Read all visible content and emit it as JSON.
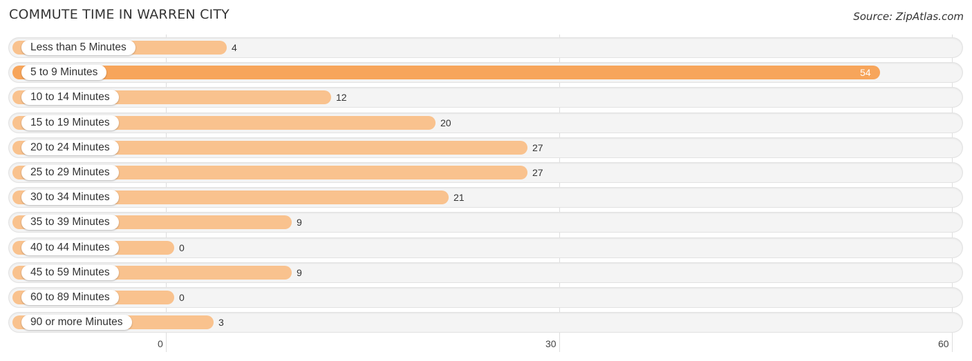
{
  "header": {
    "title": "COMMUTE TIME IN WARREN CITY",
    "source": "Source: ZipAtlas.com"
  },
  "colors": {
    "bar_normal": "#f9c28e",
    "bar_highlight": "#f7a55b",
    "row_background": "#f4f4f4"
  },
  "chart_data": {
    "type": "bar",
    "orientation": "horizontal",
    "title": "COMMUTE TIME IN WARREN CITY",
    "xlabel": "",
    "ylabel": "",
    "categories": [
      "Less than 5 Minutes",
      "5 to 9 Minutes",
      "10 to 14 Minutes",
      "15 to 19 Minutes",
      "20 to 24 Minutes",
      "25 to 29 Minutes",
      "30 to 34 Minutes",
      "35 to 39 Minutes",
      "40 to 44 Minutes",
      "45 to 59 Minutes",
      "60 to 89 Minutes",
      "90 or more Minutes"
    ],
    "values": [
      4,
      54,
      12,
      20,
      27,
      27,
      21,
      9,
      0,
      9,
      0,
      3
    ],
    "highlight_index": 1,
    "xlim": [
      0,
      60
    ],
    "x_ticks": [
      "0",
      "30",
      "60"
    ],
    "x_tick_values": [
      0,
      30,
      60
    ],
    "grid": true,
    "legend": "none"
  }
}
